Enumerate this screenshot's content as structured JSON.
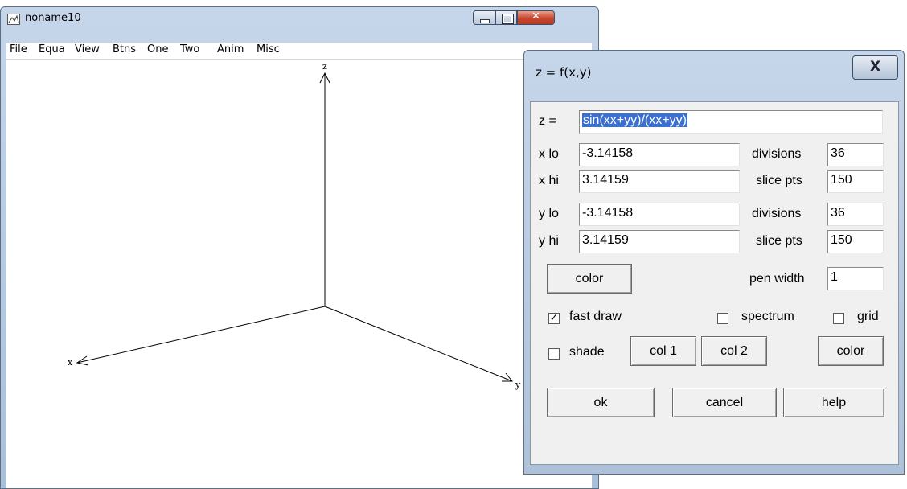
{
  "main_window": {
    "title": "noname10",
    "menu": [
      "File",
      "Equa",
      "View",
      "Btns",
      "One",
      "Two",
      "Anim",
      "Misc"
    ],
    "axes": {
      "x": "x",
      "y": "y",
      "z": "z"
    }
  },
  "dialog": {
    "title": "z = f(x,y)",
    "close_label": "X",
    "z_label": "z =",
    "z_value": "sin(xx+yy)/(xx+yy)",
    "rows": [
      {
        "label": "x lo",
        "value": "-3.14158",
        "right_label": "divisions",
        "right_value": "36"
      },
      {
        "label": "x hi",
        "value": "3.14159",
        "right_label": "slice pts",
        "right_value": "150"
      },
      {
        "label": "y lo",
        "value": "-3.14158",
        "right_label": "divisions",
        "right_value": "36"
      },
      {
        "label": "y hi",
        "value": "3.14159",
        "right_label": "slice pts",
        "right_value": "150"
      }
    ],
    "color_button": "color",
    "pen_width_label": "pen width",
    "pen_width_value": "1",
    "fast_draw": {
      "label": "fast draw",
      "checked": true
    },
    "spectrum": {
      "label": "spectrum",
      "checked": false
    },
    "grid": {
      "label": "grid",
      "checked": false
    },
    "shade": {
      "label": "shade",
      "checked": false
    },
    "col1": "col 1",
    "col2": "col 2",
    "color2_button": "color",
    "ok": "ok",
    "cancel": "cancel",
    "help": "help"
  }
}
